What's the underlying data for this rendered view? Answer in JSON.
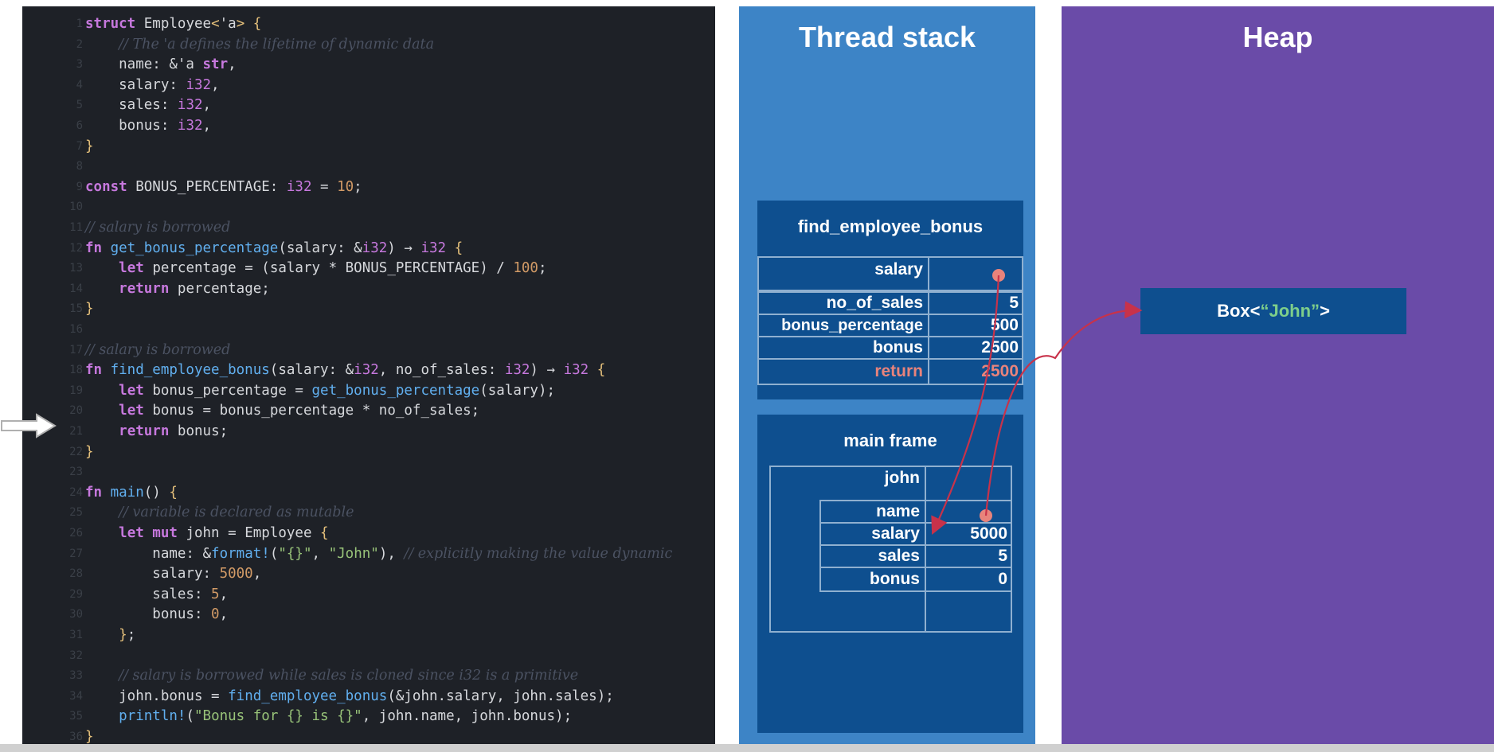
{
  "code": {
    "lines": [
      {
        "n": "1",
        "parts": [
          [
            "kw",
            "struct "
          ],
          [
            "plain",
            "Employee"
          ],
          [
            "br",
            "<"
          ],
          [
            "plain",
            "'a"
          ],
          [
            "br",
            ">"
          ],
          [
            "plain",
            " "
          ],
          [
            "br",
            "{"
          ]
        ]
      },
      {
        "n": "2",
        "parts": [
          [
            "plain",
            "    "
          ],
          [
            "cmt",
            "// The 'a defines the lifetime of dynamic data"
          ]
        ]
      },
      {
        "n": "3",
        "parts": [
          [
            "plain",
            "    name: &'a "
          ],
          [
            "kw",
            "str"
          ],
          [
            "plain",
            ","
          ]
        ]
      },
      {
        "n": "4",
        "parts": [
          [
            "plain",
            "    salary: "
          ],
          [
            "ty",
            "i32"
          ],
          [
            "plain",
            ","
          ]
        ]
      },
      {
        "n": "5",
        "parts": [
          [
            "plain",
            "    sales: "
          ],
          [
            "ty",
            "i32"
          ],
          [
            "plain",
            ","
          ]
        ]
      },
      {
        "n": "6",
        "parts": [
          [
            "plain",
            "    bonus: "
          ],
          [
            "ty",
            "i32"
          ],
          [
            "plain",
            ","
          ]
        ]
      },
      {
        "n": "7",
        "parts": [
          [
            "br",
            "}"
          ]
        ]
      },
      {
        "n": "8",
        "parts": []
      },
      {
        "n": "9",
        "parts": [
          [
            "kw",
            "const "
          ],
          [
            "plain",
            "BONUS_PERCENTAGE: "
          ],
          [
            "ty",
            "i32"
          ],
          [
            "plain",
            " = "
          ],
          [
            "num",
            "10"
          ],
          [
            "plain",
            ";"
          ]
        ]
      },
      {
        "n": "10",
        "parts": []
      },
      {
        "n": "11",
        "parts": [
          [
            "cmt",
            "// salary is borrowed"
          ]
        ]
      },
      {
        "n": "12",
        "parts": [
          [
            "kw",
            "fn "
          ],
          [
            "fnname",
            "get_bonus_percentage"
          ],
          [
            "plain",
            "(salary: &"
          ],
          [
            "ty",
            "i32"
          ],
          [
            "plain",
            ") → "
          ],
          [
            "ty",
            "i32"
          ],
          [
            "plain",
            " "
          ],
          [
            "br",
            "{"
          ]
        ]
      },
      {
        "n": "13",
        "parts": [
          [
            "plain",
            "    "
          ],
          [
            "kw",
            "let "
          ],
          [
            "plain",
            "percentage = (salary * BONUS_PERCENTAGE) / "
          ],
          [
            "num",
            "100"
          ],
          [
            "plain",
            ";"
          ]
        ]
      },
      {
        "n": "14",
        "parts": [
          [
            "plain",
            "    "
          ],
          [
            "kw",
            "return "
          ],
          [
            "plain",
            "percentage;"
          ]
        ]
      },
      {
        "n": "15",
        "parts": [
          [
            "br",
            "}"
          ]
        ]
      },
      {
        "n": "16",
        "parts": []
      },
      {
        "n": "17",
        "parts": [
          [
            "cmt",
            "// salary is borrowed"
          ]
        ]
      },
      {
        "n": "18",
        "parts": [
          [
            "kw",
            "fn "
          ],
          [
            "fnname",
            "find_employee_bonus"
          ],
          [
            "plain",
            "(salary: &"
          ],
          [
            "ty",
            "i32"
          ],
          [
            "plain",
            ", no_of_sales: "
          ],
          [
            "ty",
            "i32"
          ],
          [
            "plain",
            ") → "
          ],
          [
            "ty",
            "i32"
          ],
          [
            "plain",
            " "
          ],
          [
            "br",
            "{"
          ]
        ]
      },
      {
        "n": "19",
        "parts": [
          [
            "plain",
            "    "
          ],
          [
            "kw",
            "let "
          ],
          [
            "plain",
            "bonus_percentage = "
          ],
          [
            "fnname",
            "get_bonus_percentage"
          ],
          [
            "plain",
            "(salary);"
          ]
        ]
      },
      {
        "n": "20",
        "parts": [
          [
            "plain",
            "    "
          ],
          [
            "kw",
            "let "
          ],
          [
            "plain",
            "bonus = bonus_percentage * no_of_sales;"
          ]
        ]
      },
      {
        "n": "21",
        "parts": [
          [
            "plain",
            "    "
          ],
          [
            "kw",
            "return "
          ],
          [
            "plain",
            "bonus;"
          ]
        ]
      },
      {
        "n": "22",
        "parts": [
          [
            "br",
            "}"
          ]
        ]
      },
      {
        "n": "23",
        "parts": []
      },
      {
        "n": "24",
        "parts": [
          [
            "kw",
            "fn "
          ],
          [
            "fnname",
            "main"
          ],
          [
            "plain",
            "() "
          ],
          [
            "br",
            "{"
          ]
        ]
      },
      {
        "n": "25",
        "parts": [
          [
            "plain",
            "    "
          ],
          [
            "cmt",
            "// variable is declared as mutable"
          ]
        ]
      },
      {
        "n": "26",
        "parts": [
          [
            "plain",
            "    "
          ],
          [
            "kw",
            "let mut "
          ],
          [
            "plain",
            "john = Employee "
          ],
          [
            "br",
            "{"
          ]
        ]
      },
      {
        "n": "27",
        "parts": [
          [
            "plain",
            "        name: &"
          ],
          [
            "fnname",
            "format!"
          ],
          [
            "plain",
            "("
          ],
          [
            "str",
            "\"{}\""
          ],
          [
            "plain",
            ", "
          ],
          [
            "str",
            "\"John\""
          ],
          [
            "plain",
            "), "
          ],
          [
            "cmt",
            "// explicitly making the value dynamic"
          ]
        ]
      },
      {
        "n": "28",
        "parts": [
          [
            "plain",
            "        salary: "
          ],
          [
            "num",
            "5000"
          ],
          [
            "plain",
            ","
          ]
        ]
      },
      {
        "n": "29",
        "parts": [
          [
            "plain",
            "        sales: "
          ],
          [
            "num",
            "5"
          ],
          [
            "plain",
            ","
          ]
        ]
      },
      {
        "n": "30",
        "parts": [
          [
            "plain",
            "        bonus: "
          ],
          [
            "num",
            "0"
          ],
          [
            "plain",
            ","
          ]
        ]
      },
      {
        "n": "31",
        "parts": [
          [
            "plain",
            "    "
          ],
          [
            "br",
            "}"
          ],
          [
            "plain",
            ";"
          ]
        ]
      },
      {
        "n": "32",
        "parts": []
      },
      {
        "n": "33",
        "parts": [
          [
            "plain",
            "    "
          ],
          [
            "cmt",
            "// salary is borrowed while sales is cloned since i32 is a primitive"
          ]
        ]
      },
      {
        "n": "34",
        "parts": [
          [
            "plain",
            "    john.bonus = "
          ],
          [
            "fnname",
            "find_employee_bonus"
          ],
          [
            "plain",
            "(&john.salary, john.sales);"
          ]
        ]
      },
      {
        "n": "35",
        "parts": [
          [
            "plain",
            "    "
          ],
          [
            "fnname",
            "println!"
          ],
          [
            "plain",
            "("
          ],
          [
            "str",
            "\"Bonus for {} is {}\""
          ],
          [
            "plain",
            ", john.name, john.bonus);"
          ]
        ]
      },
      {
        "n": "36",
        "parts": [
          [
            "br",
            "}"
          ]
        ]
      }
    ]
  },
  "stack": {
    "title": "Thread stack",
    "find_frame": {
      "title": "find_employee_bonus",
      "rows": [
        {
          "label": "salary",
          "value": ""
        },
        {
          "label": "no_of_sales",
          "value": "5"
        },
        {
          "label": "bonus_percentage",
          "value": "500"
        },
        {
          "label": "bonus",
          "value": "2500"
        },
        {
          "label": "return",
          "value": "2500"
        }
      ]
    },
    "main_frame": {
      "title": "main frame",
      "var": "john",
      "rows": [
        {
          "label": "name",
          "value": ""
        },
        {
          "label": "salary",
          "value": "5000"
        },
        {
          "label": "sales",
          "value": "5"
        },
        {
          "label": "bonus",
          "value": "0"
        }
      ]
    }
  },
  "heap": {
    "title": "Heap",
    "box_prefix": "Box<",
    "box_value": "“John”",
    "box_suffix": ">"
  },
  "colors": {
    "pointer": "#e8837b",
    "stack_bg": "#3d84c6",
    "heap_bg": "#6a4ba8",
    "frame_bg": "#0e4f8f"
  }
}
